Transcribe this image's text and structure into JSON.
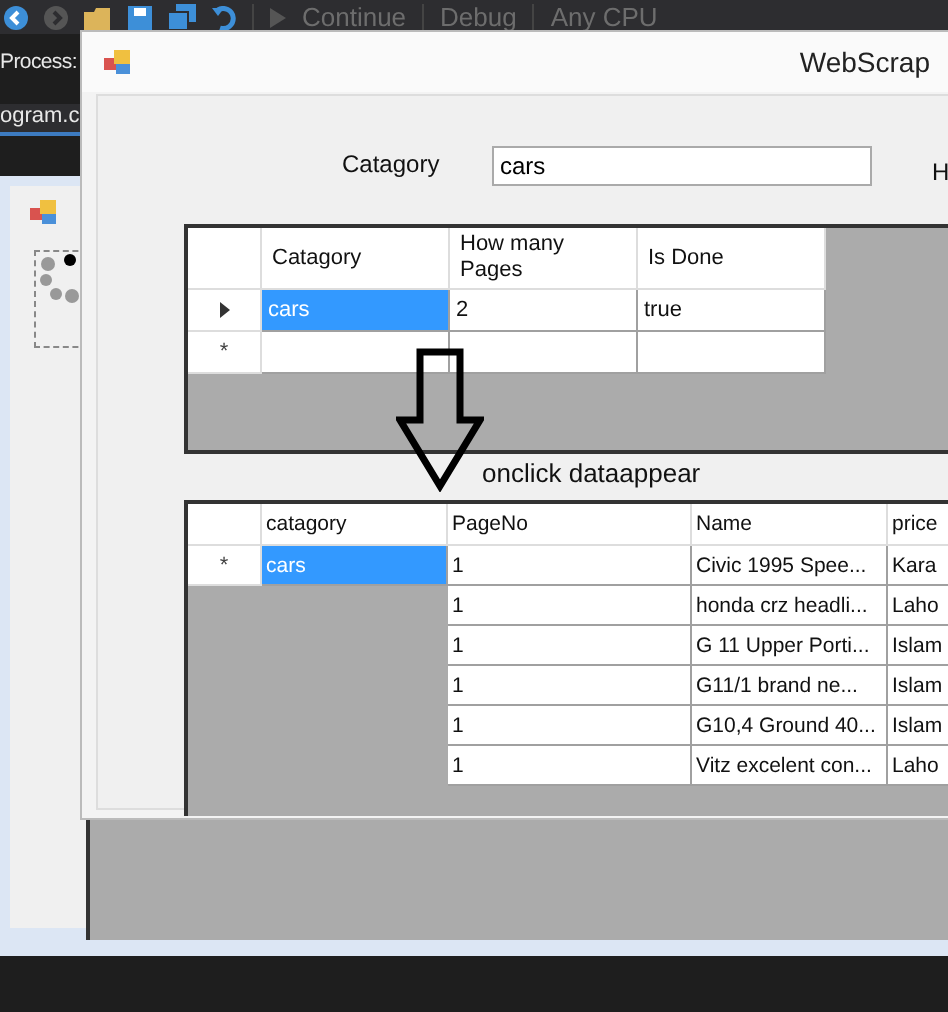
{
  "toolbar": {
    "items": [
      "Continue",
      "Debug",
      "Any CPU"
    ]
  },
  "ide": {
    "process_label": "Process:",
    "tab": "ogram.c"
  },
  "form": {
    "title": "WebScrap",
    "category_label": "Catagory",
    "category_field": {
      "value": "cars"
    },
    "label_2": "H"
  },
  "input_grid": {
    "columns": [
      "Catagory",
      "How many\nPages",
      "Is Done"
    ],
    "rows": [
      {
        "current": true,
        "cells": [
          {
            "text": "cars",
            "selected": true
          },
          {
            "text": "2",
            "selected": false
          },
          {
            "text": "true",
            "selected": false
          }
        ]
      },
      {
        "current": false,
        "marker": "*"
      }
    ]
  },
  "annotation": "onclick dataappear",
  "output_grid": {
    "columns": [
      "catagory",
      "PageNo",
      "Name",
      "price"
    ],
    "rows": [
      {
        "marker": "*",
        "selected": true,
        "cells": [
          "cars",
          "1",
          "Civic 1995 Spee...",
          "Kara"
        ]
      },
      {
        "selected": false,
        "cells": [
          "",
          "1",
          "honda crz headli...",
          "Laho"
        ]
      },
      {
        "selected": false,
        "cells": [
          "",
          "1",
          "G 11 Upper Porti...",
          "Islam"
        ]
      },
      {
        "selected": false,
        "cells": [
          "",
          "1",
          "G11/1 brand ne...",
          "Islam"
        ]
      },
      {
        "selected": false,
        "cells": [
          "",
          "1",
          "G10,4 Ground 40...",
          "Islam"
        ]
      },
      {
        "selected": false,
        "cells": [
          "",
          "1",
          "Vitz excelent con...",
          "Laho"
        ]
      }
    ]
  }
}
